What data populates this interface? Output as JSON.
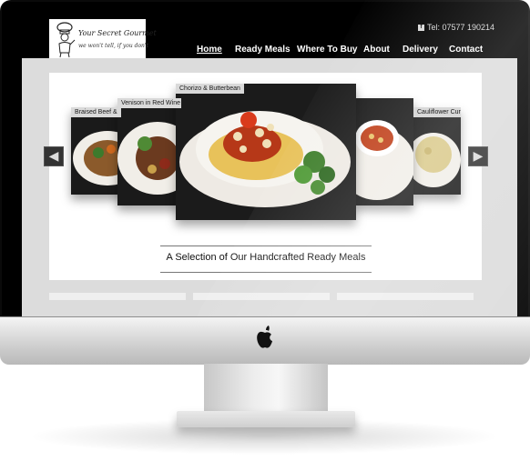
{
  "header": {
    "logo_text": "Your Secret Gourmet",
    "logo_tagline": "we won't tell, if you don't",
    "facebook_icon": "f",
    "phone": "Tel: 07577 190214"
  },
  "nav": {
    "items": [
      {
        "label": "Home",
        "active": true
      },
      {
        "label": "Ready Meals",
        "active": false
      },
      {
        "label": "Where To Buy",
        "active": false
      },
      {
        "label": "About",
        "active": false
      },
      {
        "label": "Delivery",
        "active": false
      },
      {
        "label": "Contact",
        "active": false
      }
    ]
  },
  "carousel": {
    "slides": [
      {
        "caption": "Braised Beef &"
      },
      {
        "caption": "Venison in Red Wine"
      },
      {
        "caption": "Chorizo & Butterbean"
      },
      {
        "caption": ""
      },
      {
        "caption": "Cauliflower Curry"
      }
    ],
    "prev_icon": "◀",
    "next_icon": "▶"
  },
  "main": {
    "heading": "A Selection of Our Handcrafted Ready Meals"
  },
  "colors": {
    "accent": "#000000",
    "panel": "#ffffff",
    "background": "#dcdcdc"
  }
}
